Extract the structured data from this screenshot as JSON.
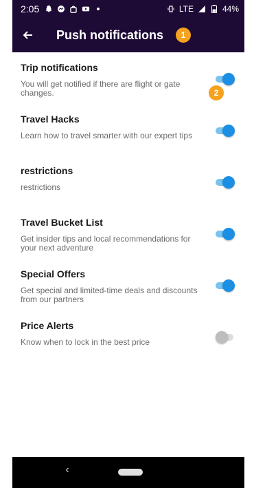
{
  "status_bar": {
    "time": "2:05",
    "network": "LTE",
    "battery": "44%"
  },
  "app_bar": {
    "title": "Push notifications",
    "badge": "1"
  },
  "settings": [
    {
      "name": "Trip notifications",
      "description": "You will get notified if there are flight or gate changes.",
      "enabled": true,
      "badge": "2"
    },
    {
      "name": "Travel Hacks",
      "description": "Learn how to travel smarter with our expert tips",
      "enabled": true
    },
    {
      "name": "restrictions",
      "description": "restrictions",
      "enabled": true
    },
    {
      "name": "Travel Bucket List",
      "description": "Get insider tips and local recommendations for your next adventure",
      "enabled": true
    },
    {
      "name": "Special Offers",
      "description": "Get special and limited-time deals and discounts from our partners",
      "enabled": true
    },
    {
      "name": "Price Alerts",
      "description": "Know when to lock in the best price",
      "enabled": false
    }
  ],
  "colors": {
    "header_bg": "#1d0a35",
    "badge": "#f6a21e",
    "toggle_on": "#1a8fe4",
    "toggle_off": "#bdbdbd"
  },
  "icons": {
    "back": "arrow-left-icon",
    "nav_back": "chevron-left-icon",
    "nav_home": "home-pill-icon"
  }
}
